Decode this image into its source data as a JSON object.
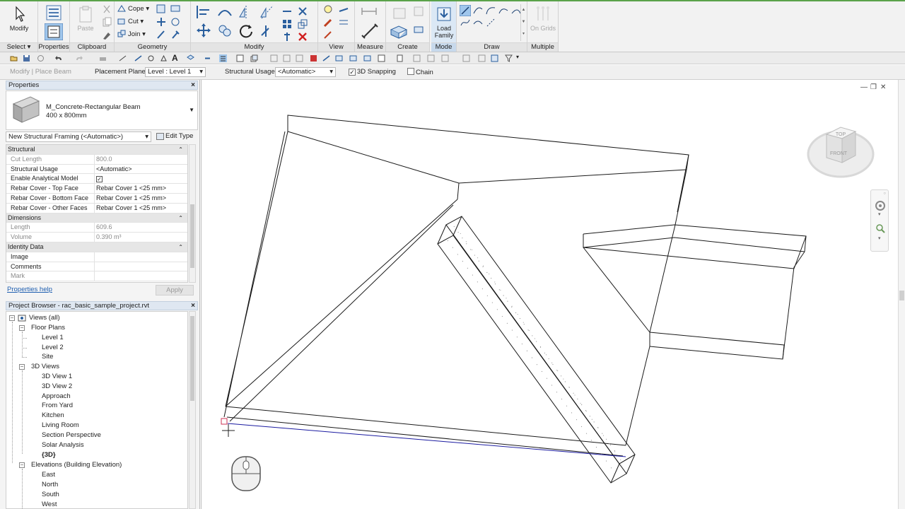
{
  "ribbon": {
    "modify": {
      "label": "Modify",
      "panel": "Select"
    },
    "properties_btn": {
      "label": "Properties"
    },
    "clipboard": {
      "paste": "Paste",
      "panel": "Clipboard"
    },
    "geometry": {
      "cope": "Cope",
      "cut": "Cut",
      "join": "Join",
      "panel": "Geometry"
    },
    "modify_panel": "Modify",
    "view_panel": "View",
    "measure_panel": "Measure",
    "create_panel": "Create",
    "mode": {
      "load_family": "Load Family",
      "panel": "Mode"
    },
    "draw_panel": "Draw",
    "multiple": {
      "on_grids": "On Grids",
      "panel": "Multiple"
    }
  },
  "options_bar": {
    "context": "Modify | Place Beam",
    "placement_plane_label": "Placement Plane:",
    "placement_plane_value": "Level : Level 1",
    "structural_usage_label": "Structural Usage:",
    "structural_usage_value": "<Automatic>",
    "snapping_label": "3D Snapping",
    "snapping_checked": true,
    "chain_label": "Chain",
    "chain_checked": false
  },
  "properties": {
    "title": "Properties",
    "type_family": "M_Concrete-Rectangular Beam",
    "type_size": "400 x 800mm",
    "instance_selector": "New Structural Framing (<Automatic>)",
    "edit_type": "Edit Type",
    "groups": [
      {
        "name": "Structural",
        "rows": [
          {
            "label": "Cut Length",
            "value": "800.0",
            "dim": true
          },
          {
            "label": "Structural Usage",
            "value": "<Automatic>",
            "dim": false
          },
          {
            "label": "Enable Analytical Model",
            "value": "",
            "check": true,
            "dim": false
          },
          {
            "label": "Rebar Cover - Top Face",
            "value": "Rebar Cover 1 <25 mm>",
            "dim": false
          },
          {
            "label": "Rebar Cover - Bottom Face",
            "value": "Rebar Cover 1 <25 mm>",
            "dim": false
          },
          {
            "label": "Rebar Cover - Other Faces",
            "value": "Rebar Cover 1 <25 mm>",
            "dim": false
          }
        ]
      },
      {
        "name": "Dimensions",
        "rows": [
          {
            "label": "Length",
            "value": "609.6",
            "dim": true
          },
          {
            "label": "Volume",
            "value": "0.390 m³",
            "dim": true
          }
        ]
      },
      {
        "name": "Identity Data",
        "rows": [
          {
            "label": "Image",
            "value": "",
            "dim": false
          },
          {
            "label": "Comments",
            "value": "",
            "dim": false
          },
          {
            "label": "Mark",
            "value": "",
            "dim": true
          }
        ]
      }
    ],
    "help_link": "Properties help",
    "apply": "Apply"
  },
  "project_browser": {
    "title": "Project Browser - rac_basic_sample_project.rvt",
    "root": "Views (all)",
    "floor_plans": {
      "label": "Floor Plans",
      "items": [
        "Level 1",
        "Level 2",
        "Site"
      ]
    },
    "views_3d": {
      "label": "3D Views",
      "items": [
        "3D View 1",
        "3D View 2",
        "Approach",
        "From Yard",
        "Kitchen",
        "Living Room",
        "Section Perspective",
        "Solar Analysis",
        "{3D}"
      ]
    },
    "elevations": {
      "label": "Elevations (Building Elevation)",
      "items": [
        "East",
        "North",
        "South",
        "West"
      ]
    }
  },
  "viewcube": {
    "top": "TOP",
    "front": "FRONT"
  },
  "colors": {
    "ribbon_accent": "#5aa24a",
    "selection_blue": "#1f5fb0",
    "beam_preview": "#1a1aa0"
  }
}
